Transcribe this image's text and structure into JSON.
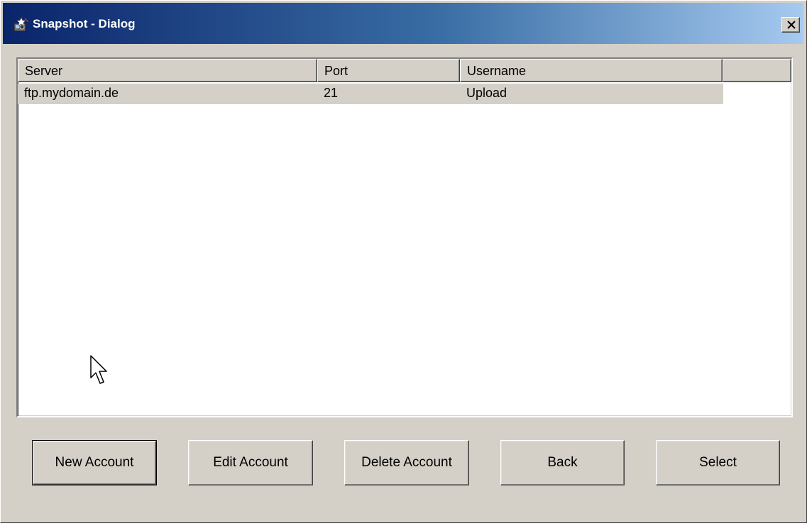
{
  "window": {
    "title": "Snapshot - Dialog",
    "title_icon": "snapshot-app-icon",
    "close_icon": "close-icon"
  },
  "colors": {
    "face": "#d4d0c8",
    "title_start": "#0a246a",
    "title_end": "#a6caf0",
    "selection": "#d4d0c8"
  },
  "list": {
    "columns": [
      "Server",
      "Port",
      "Username"
    ],
    "rows": [
      {
        "server": "ftp.mydomain.de",
        "port": "21",
        "username": "Upload"
      }
    ]
  },
  "buttons": {
    "new_account": "New Account",
    "edit_account": "Edit Account",
    "delete_account": "Delete Account",
    "back": "Back",
    "select": "Select"
  }
}
